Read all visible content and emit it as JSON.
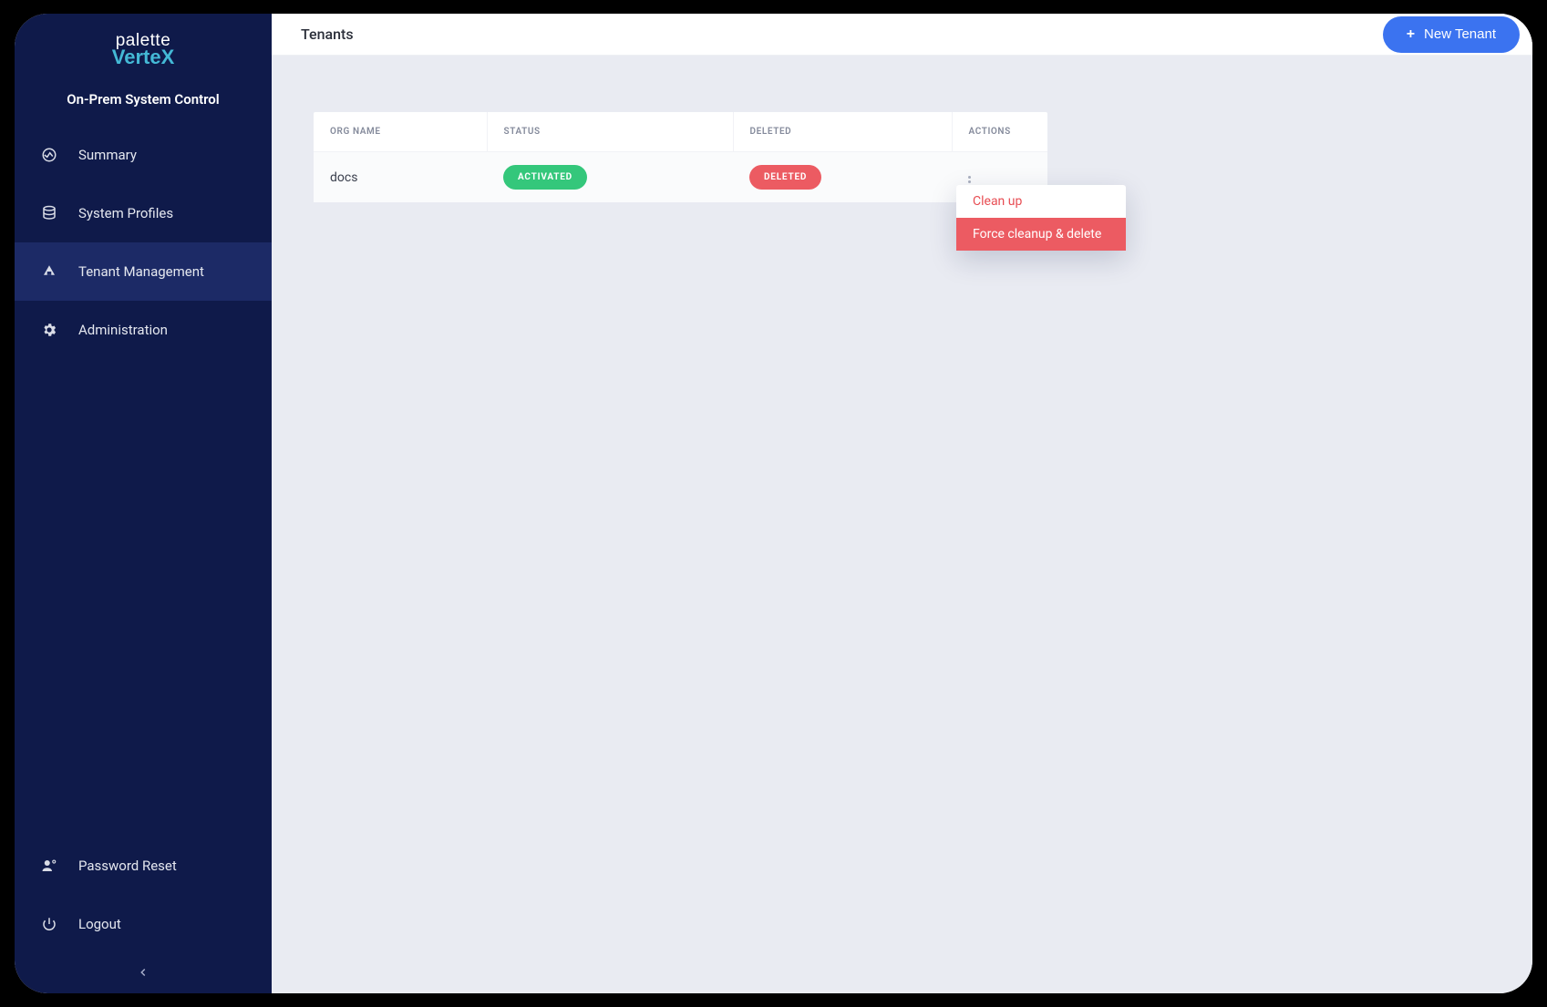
{
  "brand": {
    "line1": "palette",
    "line2": "VerteX"
  },
  "subtitle": "On-Prem System Control",
  "sidebar": {
    "items": [
      {
        "label": "Summary"
      },
      {
        "label": "System Profiles"
      },
      {
        "label": "Tenant Management"
      },
      {
        "label": "Administration"
      }
    ],
    "bottom": [
      {
        "label": "Password Reset"
      },
      {
        "label": "Logout"
      }
    ]
  },
  "header": {
    "title": "Tenants",
    "new_button": "New Tenant"
  },
  "table": {
    "columns": {
      "org": "Org Name",
      "status": "Status",
      "deleted": "Deleted",
      "actions": "Actions"
    },
    "rows": [
      {
        "org": "docs",
        "status": "ACTIVATED",
        "deleted": "DELETED"
      }
    ]
  },
  "dropdown": {
    "cleanup": "Clean up",
    "force": "Force cleanup & delete"
  }
}
